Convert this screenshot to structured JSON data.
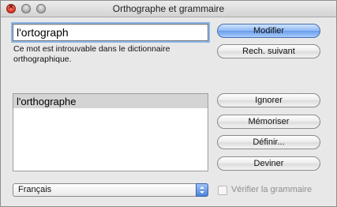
{
  "window": {
    "title": "Orthographe et grammaire"
  },
  "spelling": {
    "word": "l'ortograph",
    "message": "Ce mot est introuvable dans le dictionnaire orthographique."
  },
  "guesses": [
    "l'orthographe"
  ],
  "buttons": {
    "change": "Modifier",
    "find_next": "Rech. suivant",
    "ignore": "Ignorer",
    "learn": "Mémoriser",
    "define": "Définir...",
    "guess": "Deviner"
  },
  "language": {
    "selected": "Français"
  },
  "grammar": {
    "label": "Vérifier la grammaire",
    "checked": false,
    "enabled": false
  },
  "icons": {
    "close": "close-icon",
    "minimize": "minimize-icon",
    "zoom": "zoom-icon",
    "popup_arrows": "popup-arrows-icon"
  }
}
